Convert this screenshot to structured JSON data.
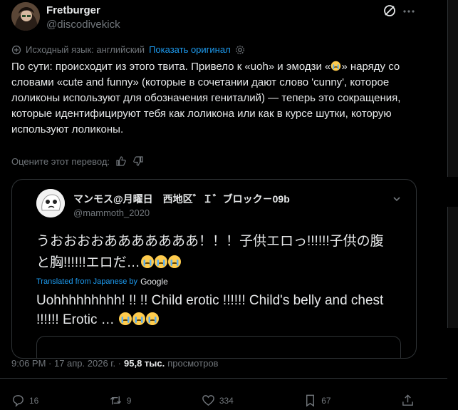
{
  "author": {
    "name": "Fretburger",
    "handle": "@discodivekick"
  },
  "translation_notice": {
    "source_language": "Исходный язык: английский",
    "show_original": "Показать оригинал"
  },
  "body": {
    "line1_a": "По сути: происходит из этого твита. Привело к «uoh» и эмодзи «",
    "line1_b": "» наряду со словами «cute and funny» (которые в сочетании дают слово 'cunny', которое лоликоны используют для обозначения гениталий) — теперь это сокращения, которые идентифицируют тебя как лоликона или как в курсе шутки, которую используют лоликоны."
  },
  "rate_translation": {
    "label": "Оцените этот перевод:"
  },
  "quoted": {
    "name": "マンモス@月曜日　西地区゛Ｉ゛ブロック－09b",
    "handle": "@mammoth_2020",
    "original_text": "うおおおおあああああああ！！！子供エロっ!!!!!!子供の腹と胸!!!!!!エロだ…",
    "translated_by": "Translated from Japanese by",
    "translator": "Google",
    "translated_text": "Uohhhhhhhhh! !! !! Child erotic !!!!!! Child's belly and chest !!!!!! Erotic …"
  },
  "meta": {
    "time": "9:06 PM · 17 апр. 2026 г. ·",
    "views_count": "95,8 тыс.",
    "views_label": "просмотров"
  },
  "actions": {
    "replies": "16",
    "reposts": "9",
    "likes": "334",
    "bookmarks": "67"
  },
  "icons": [
    "grok-icon",
    "more-icon",
    "translate-icon",
    "settings-icon",
    "thumbs-up-icon",
    "thumbs-down-icon",
    "reply-icon",
    "repost-icon",
    "like-icon",
    "views-icon",
    "share-icon",
    "crying-emoji-icon"
  ],
  "colors": {
    "accent": "#1d9bf0",
    "muted": "#71767b",
    "text": "#e7e9ea",
    "background": "#000000",
    "border": "#2f3336"
  }
}
